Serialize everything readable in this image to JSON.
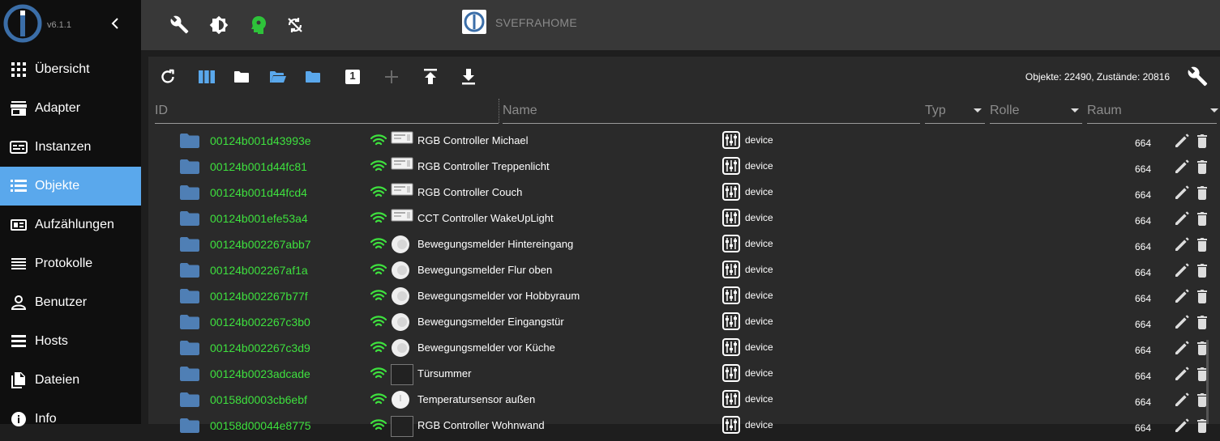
{
  "app": {
    "version": "v6.1.1",
    "host_name": "SVEFRAHOME"
  },
  "colors": {
    "accent": "#5aa8ec",
    "object_id": "#3ee03e",
    "wifi": "#3ee03e",
    "folder": "#4f7fb5",
    "sidebar_bg": "#0f0f0f",
    "topbar_bg": "#383838"
  },
  "sidebar": {
    "items": [
      {
        "label": "Übersicht",
        "icon": "grid-icon"
      },
      {
        "label": "Adapter",
        "icon": "store-icon"
      },
      {
        "label": "Instanzen",
        "icon": "instances-icon"
      },
      {
        "label": "Objekte",
        "icon": "list-icon",
        "active": true
      },
      {
        "label": "Aufzählungen",
        "icon": "enum-icon"
      },
      {
        "label": "Protokolle",
        "icon": "log-icon"
      },
      {
        "label": "Benutzer",
        "icon": "user-icon"
      },
      {
        "label": "Hosts",
        "icon": "hosts-icon"
      },
      {
        "label": "Dateien",
        "icon": "files-icon"
      },
      {
        "label": "Info",
        "icon": "info-icon"
      }
    ]
  },
  "toolbar": {
    "counts": "Objekte: 22490, Zustände: 20816",
    "badge": "1"
  },
  "filters": {
    "id": "ID",
    "name": "Name",
    "typ": "Typ",
    "rolle": "Rolle",
    "raum": "Raum"
  },
  "rows": [
    {
      "id": "00124b001d43993e",
      "name": "RGB Controller Michael",
      "img": "controller",
      "type": "device",
      "acl": "664"
    },
    {
      "id": "00124b001d44fc81",
      "name": "RGB Controller Treppenlicht",
      "img": "controller",
      "type": "device",
      "acl": "664"
    },
    {
      "id": "00124b001d44fcd4",
      "name": "RGB Controller Couch",
      "img": "controller",
      "type": "device",
      "acl": "664"
    },
    {
      "id": "00124b001efe53a4",
      "name": "CCT Controller WakeUpLight",
      "img": "controller",
      "type": "device",
      "acl": "664"
    },
    {
      "id": "00124b002267abb7",
      "name": "Bewegungsmelder Hintereingang",
      "img": "sensor",
      "type": "device",
      "acl": "664"
    },
    {
      "id": "00124b002267af1a",
      "name": "Bewegungsmelder Flur oben",
      "img": "sensor",
      "type": "device",
      "acl": "664"
    },
    {
      "id": "00124b002267b77f",
      "name": "Bewegungsmelder vor Hobbyraum",
      "img": "sensor",
      "type": "device",
      "acl": "664"
    },
    {
      "id": "00124b002267c3b0",
      "name": "Bewegungsmelder Eingangstür",
      "img": "sensor",
      "type": "device",
      "acl": "664"
    },
    {
      "id": "00124b002267c3d9",
      "name": "Bewegungsmelder vor Küche",
      "img": "sensor",
      "type": "device",
      "acl": "664"
    },
    {
      "id": "00124b0023adcade",
      "name": "Türsummer",
      "img": "box",
      "type": "device",
      "acl": "664"
    },
    {
      "id": "00158d0003cb6ebf",
      "name": "Temperatursensor außen",
      "img": "temp",
      "type": "device",
      "acl": "664"
    },
    {
      "id": "00158d00044e8775",
      "name": "RGB Controller Wohnwand",
      "img": "box",
      "type": "device",
      "acl": "664"
    }
  ]
}
